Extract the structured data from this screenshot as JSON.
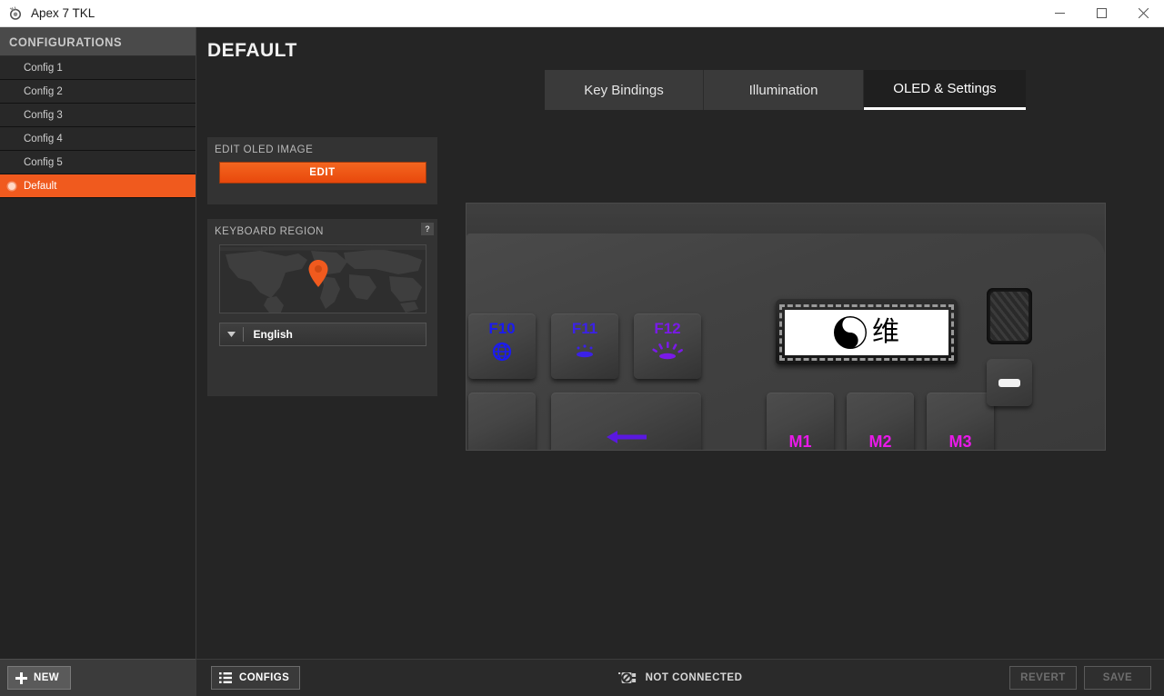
{
  "window": {
    "title": "Apex 7 TKL",
    "app_icon": "steelseries-logo-icon",
    "minimize_label": "–",
    "maximize_label": "□",
    "close_label": "✕"
  },
  "sidebar": {
    "header": "CONFIGURATIONS",
    "items": [
      {
        "label": "Config 1",
        "selected": false
      },
      {
        "label": "Config 2",
        "selected": false
      },
      {
        "label": "Config 3",
        "selected": false
      },
      {
        "label": "Config 4",
        "selected": false
      },
      {
        "label": "Config 5",
        "selected": false
      },
      {
        "label": "Default",
        "selected": true
      }
    ],
    "new_button": "NEW"
  },
  "main": {
    "page_title": "DEFAULT",
    "tabs": [
      {
        "label": "Key Bindings",
        "active": false
      },
      {
        "label": "Illumination",
        "active": false
      },
      {
        "label": "OLED & Settings",
        "active": true
      }
    ]
  },
  "oled_panel": {
    "title": "EDIT OLED IMAGE",
    "edit_button": "EDIT"
  },
  "region_panel": {
    "title": "KEYBOARD REGION",
    "help_badge": "?",
    "map_marker": "location-pin-icon",
    "language_value": "English",
    "dropdown_arrow": "▼"
  },
  "keyboard_preview": {
    "keys": [
      {
        "label": "F10",
        "color": "#1b1bf0",
        "icon": "globe-icon"
      },
      {
        "label": "F11",
        "color": "#3b21e8",
        "icon": "brightness-low-icon"
      },
      {
        "label": "F12",
        "color": "#7a1ae8",
        "icon": "brightness-high-icon"
      }
    ],
    "macro_keys": [
      {
        "label": "M1",
        "color": "#e81ae8"
      },
      {
        "label": "M2",
        "color": "#e81ae8"
      },
      {
        "label": "M3",
        "color": "#e81ae8"
      }
    ],
    "oled_content": {
      "symbol": "yin-yang-icon",
      "character": "维"
    },
    "roller": "volume-roller",
    "mute_key": "mute-button"
  },
  "footer": {
    "configs_button": "CONFIGS",
    "connection_status": "NOT CONNECTED",
    "connection_icon": "usb-disconnected-icon",
    "revert_button": "REVERT",
    "save_button": "SAVE"
  },
  "colors": {
    "accent": "#f05a1e",
    "panel": "#333333",
    "background": "#252525",
    "sidebar": "#232323"
  }
}
